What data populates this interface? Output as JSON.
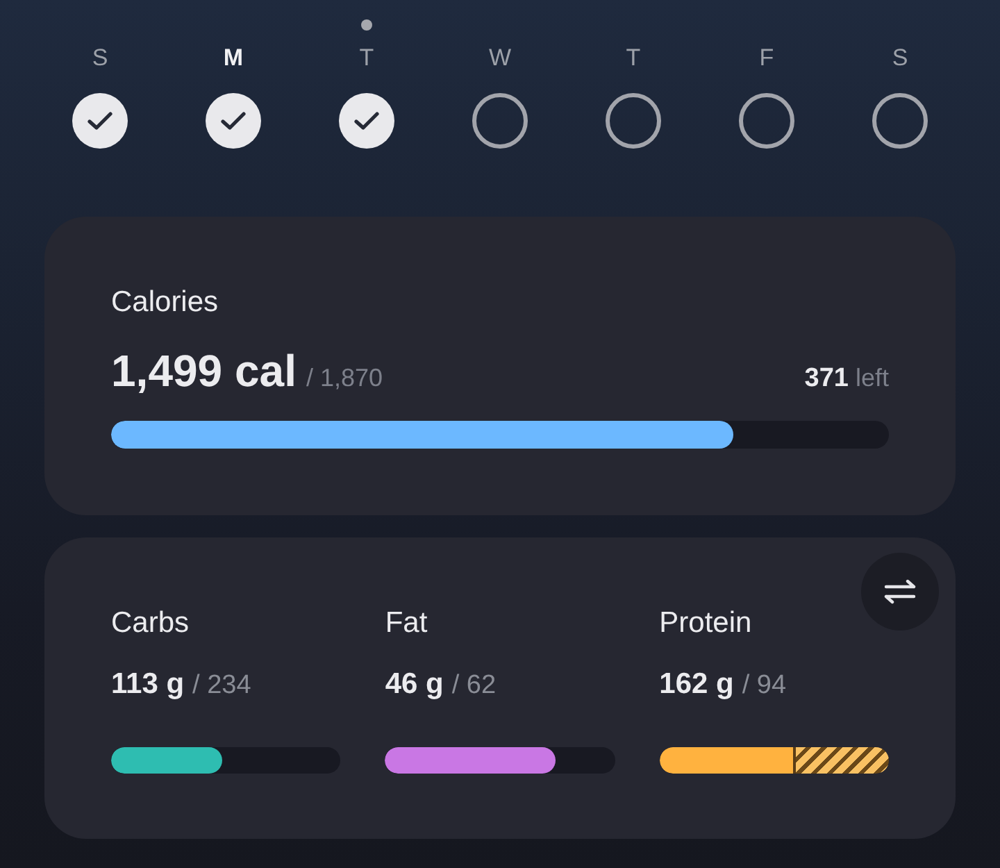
{
  "days": [
    {
      "letter": "S",
      "checked": true,
      "selected": false,
      "today": false
    },
    {
      "letter": "M",
      "checked": true,
      "selected": true,
      "today": false
    },
    {
      "letter": "T",
      "checked": true,
      "selected": false,
      "today": true
    },
    {
      "letter": "W",
      "checked": false,
      "selected": false,
      "today": false
    },
    {
      "letter": "T",
      "checked": false,
      "selected": false,
      "today": false
    },
    {
      "letter": "F",
      "checked": false,
      "selected": false,
      "today": false
    },
    {
      "letter": "S",
      "checked": false,
      "selected": false,
      "today": false
    }
  ],
  "calories": {
    "title": "Calories",
    "consumed": "1,499 cal",
    "goal": "/ 1,870",
    "remaining": "371",
    "remaining_label": "left",
    "level": 0.8,
    "color": "#6cb8ff"
  },
  "macros": [
    {
      "name": "Carbs",
      "value": "113 g",
      "goal": "/ 234",
      "level": 0.485,
      "over": false,
      "color": "#2ebdb1"
    },
    {
      "name": "Fat",
      "value": "46 g",
      "goal": "/ 62",
      "level": 0.742,
      "over": false,
      "color": "#c977e4"
    },
    {
      "name": "Protein",
      "value": "162 g",
      "goal": "/ 94",
      "level": 0.58,
      "over": true,
      "color": "#ffb23f"
    }
  ]
}
